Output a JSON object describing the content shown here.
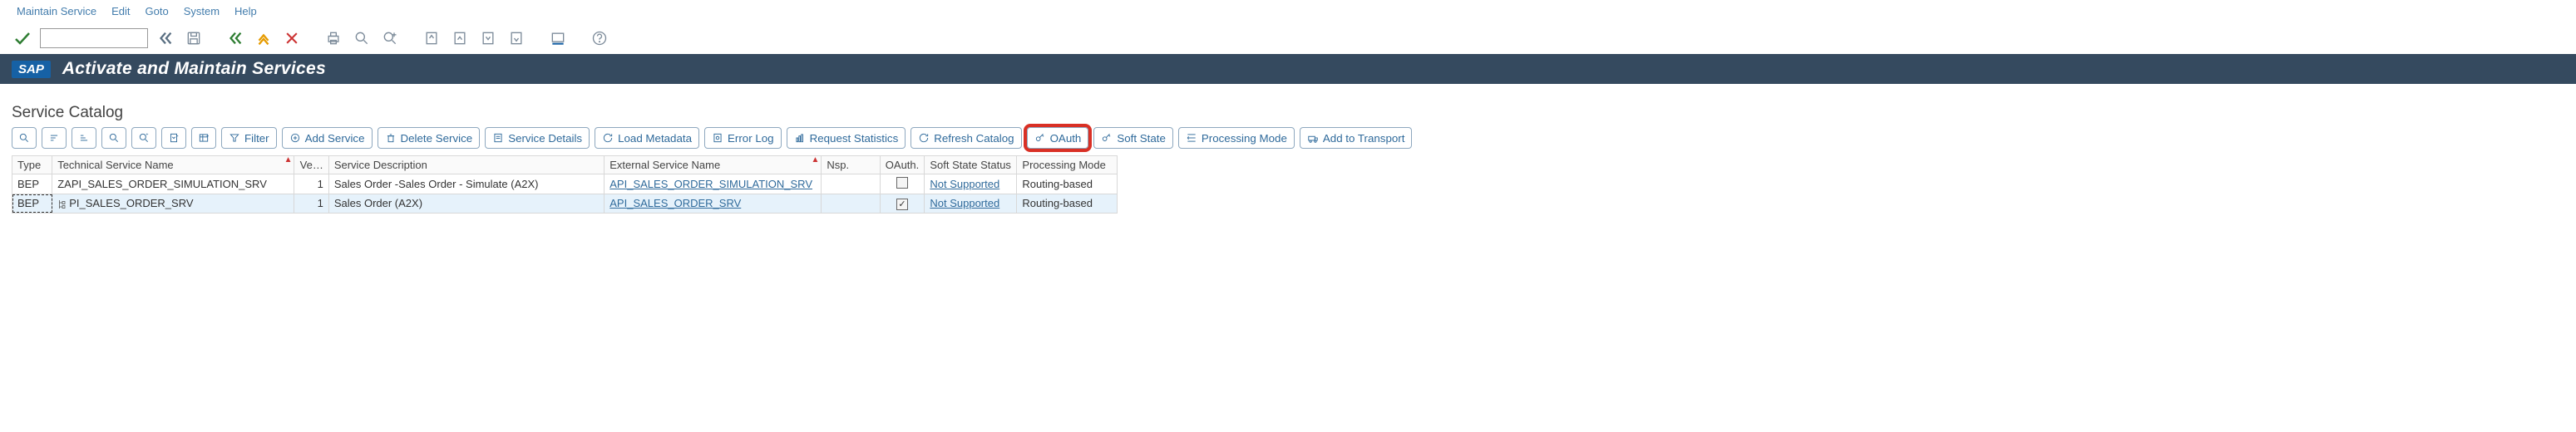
{
  "menu": {
    "items": [
      "Maintain Service",
      "Edit",
      "Goto",
      "System",
      "Help"
    ]
  },
  "command_input": {
    "value": ""
  },
  "title": "Activate and Maintain Services",
  "section_title": "Service Catalog",
  "actions": {
    "filter": "Filter",
    "add_service": "Add Service",
    "delete_service": "Delete Service",
    "service_details": "Service Details",
    "load_metadata": "Load Metadata",
    "error_log": "Error Log",
    "request_statistics": "Request Statistics",
    "refresh_catalog": "Refresh Catalog",
    "oauth": "OAuth",
    "soft_state": "Soft State",
    "processing_mode": "Processing Mode",
    "add_to_transport": "Add to Transport"
  },
  "columns": {
    "type": "Type",
    "tech_name": "Technical Service Name",
    "ve": "Ve…",
    "desc": "Service Description",
    "ext": "External Service Name",
    "nsp": "Nsp.",
    "oauth": "OAuth.",
    "soft": "Soft State Status",
    "proc": "Processing Mode"
  },
  "rows": [
    {
      "type": "BEP",
      "tech_name": "ZAPI_SALES_ORDER_SIMULATION_SRV",
      "ve": "1",
      "desc": "Sales Order -Sales Order - Simulate (A2X)",
      "ext": "API_SALES_ORDER_SIMULATION_SRV",
      "nsp": "",
      "oauth_checked": false,
      "soft": "Not Supported",
      "proc": "Routing-based",
      "selected": false,
      "hier": false
    },
    {
      "type": "BEP",
      "tech_name": "PI_SALES_ORDER_SRV",
      "ve": "1",
      "desc": "Sales Order (A2X)",
      "ext": "API_SALES_ORDER_SRV",
      "nsp": "",
      "oauth_checked": true,
      "soft": "Not Supported",
      "proc": "Routing-based",
      "selected": true,
      "hier": true
    }
  ]
}
